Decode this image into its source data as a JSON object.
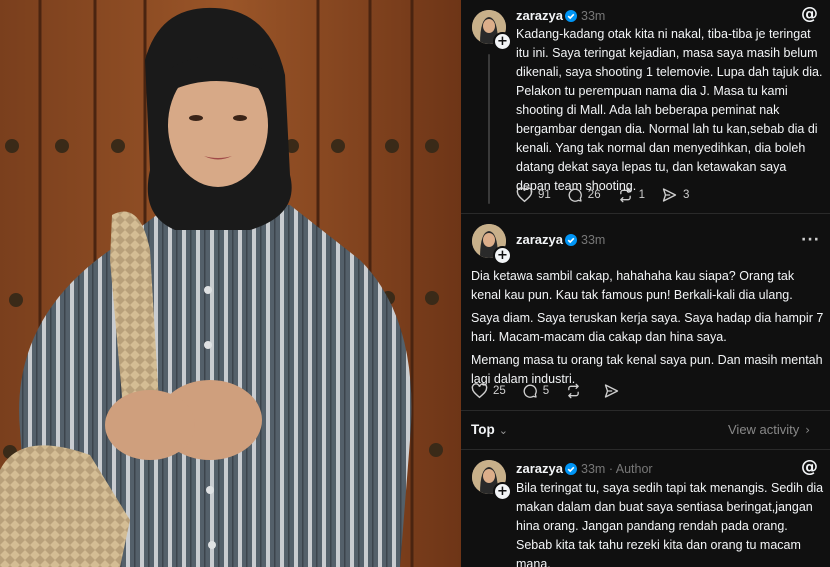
{
  "posts": [
    {
      "username": "zarazya",
      "time": "33m",
      "author_tag": "",
      "paragraphs": [
        "Kadang-kadang otak kita ni nakal, tiba-tiba je teringat itu ini. Saya teringat kejadian, masa saya masih belum dikenali, saya shooting 1 telemovie. Lupa dah tajuk dia. Pelakon tu perempuan nama dia J. Masa tu kami shooting di Mall. Ada lah beberapa peminat nak bergambar dengan dia. Normal lah tu kan,sebab dia di kenali. Yang tak normal dan menyedihkan, dia boleh datang dekat saya lepas tu, dan ketawakan saya depan team shooting."
      ],
      "counts": {
        "likes": "91",
        "replies": "26",
        "reposts": "1",
        "shares": "3"
      }
    },
    {
      "username": "zarazya",
      "time": "33m",
      "author_tag": "",
      "paragraphs": [
        "Dia ketawa sambil cakap, hahahaha kau siapa? Orang tak kenal kau pun. Kau tak famous pun! Berkali-kali dia ulang.",
        "Saya diam. Saya teruskan kerja saya. Saya hadap dia hampir 7 hari. Macam-macam dia cakap dan hina saya.",
        "Memang masa tu orang tak kenal saya pun. Dan masih mentah lagi dalam industri."
      ],
      "counts": {
        "likes": "25",
        "replies": "5",
        "reposts": "",
        "shares": ""
      }
    },
    {
      "username": "zarazya",
      "time": "33m",
      "author_tag": "· Author",
      "paragraphs": [
        "Bila teringat tu, saya sedih tapi tak menangis. Sedih dia makan dalam dan buat saya sentiasa beringat,jangan hina orang. Jangan pandang rendah pada orang. Sebab kita tak tahu rezeki kita dan orang tu macam mana."
      ]
    }
  ],
  "sort": {
    "label": "Top",
    "chevron": "⌄"
  },
  "view_activity": {
    "label": "View activity",
    "chevron": "›"
  },
  "icons": {
    "threads": "@",
    "more": "···",
    "plus": "+"
  },
  "colors": {
    "panel_bg": "#101010",
    "verified": "#0095f6",
    "text": "#f3f5f7",
    "muted": "#777777"
  }
}
